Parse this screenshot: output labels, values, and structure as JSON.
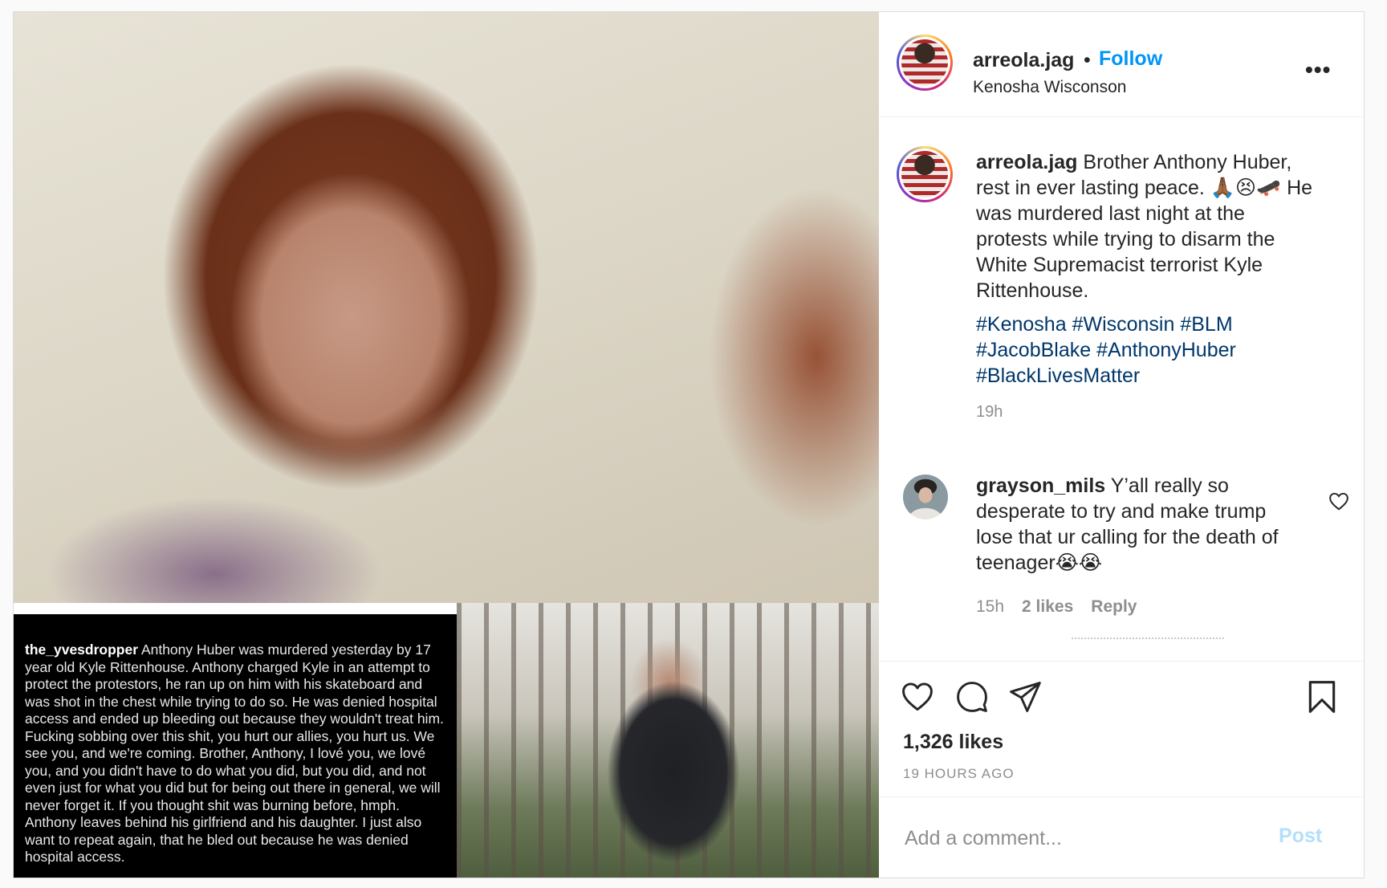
{
  "post": {
    "username": "arreola.jag",
    "separator": "•",
    "follow_label": "Follow",
    "location": "Kenosha Wisconson",
    "more_label": "•••",
    "caption": {
      "username": "arreola.jag",
      "text": "Brother Anthony Huber, rest in ever lasting peace. 🙏🏾😣🛹 He was murdered last night at the protests while trying to disarm the White Supremacist terrorist Kyle Rittenhouse.",
      "hashtags": [
        "#Kenosha",
        "#Wisconsin",
        "#BLM",
        "#JacobBlake",
        "#AnthonyHuber",
        "#BlackLivesMatter"
      ],
      "time": "19h"
    },
    "comments": [
      {
        "username": "grayson_mils",
        "text": "Y’all really so desperate to try and make trump lose that ur calling for the death of teenager😭😭",
        "time": "15h",
        "likes": "2 likes",
        "reply_label": "Reply"
      }
    ],
    "likes_count": "1,326 likes",
    "posted_ago": "19 HOURS AGO",
    "comment_placeholder": "Add a comment...",
    "post_label": "Post"
  },
  "media": {
    "image_caption_user": "the_yvesdropper",
    "image_caption_text": "Anthony Huber was murdered yesterday by 17 year old Kyle Rittenhouse. Anthony charged Kyle in an attempt to protect the protestors, he ran up on him with his skateboard and was shot in the chest while trying to do so. He was denied hospital access and ended up bleeding out because they wouldn't treat him. Fucking sobbing over this shit, you hurt our allies, you hurt us. We see you, and we're coming. Brother, Anthony, I lové you, we lové you, and you didn't have to do what you did, but you did, and not even just for what you did but for being out there in general, we will never forget it. If you thought shit was burning before, hmph. Anthony leaves behind his girlfriend and his daughter. I just also want to repeat again, that he bled out because he was denied hospital access."
  },
  "colors": {
    "link_blue": "#0095f6",
    "hashtag_blue": "#00376b",
    "muted_gray": "#8e8e8e",
    "post_disabled": "#b2dffc"
  },
  "icons": [
    "heart-icon",
    "comment-icon",
    "share-icon",
    "bookmark-icon",
    "more-options-icon",
    "comment-like-heart-icon"
  ]
}
